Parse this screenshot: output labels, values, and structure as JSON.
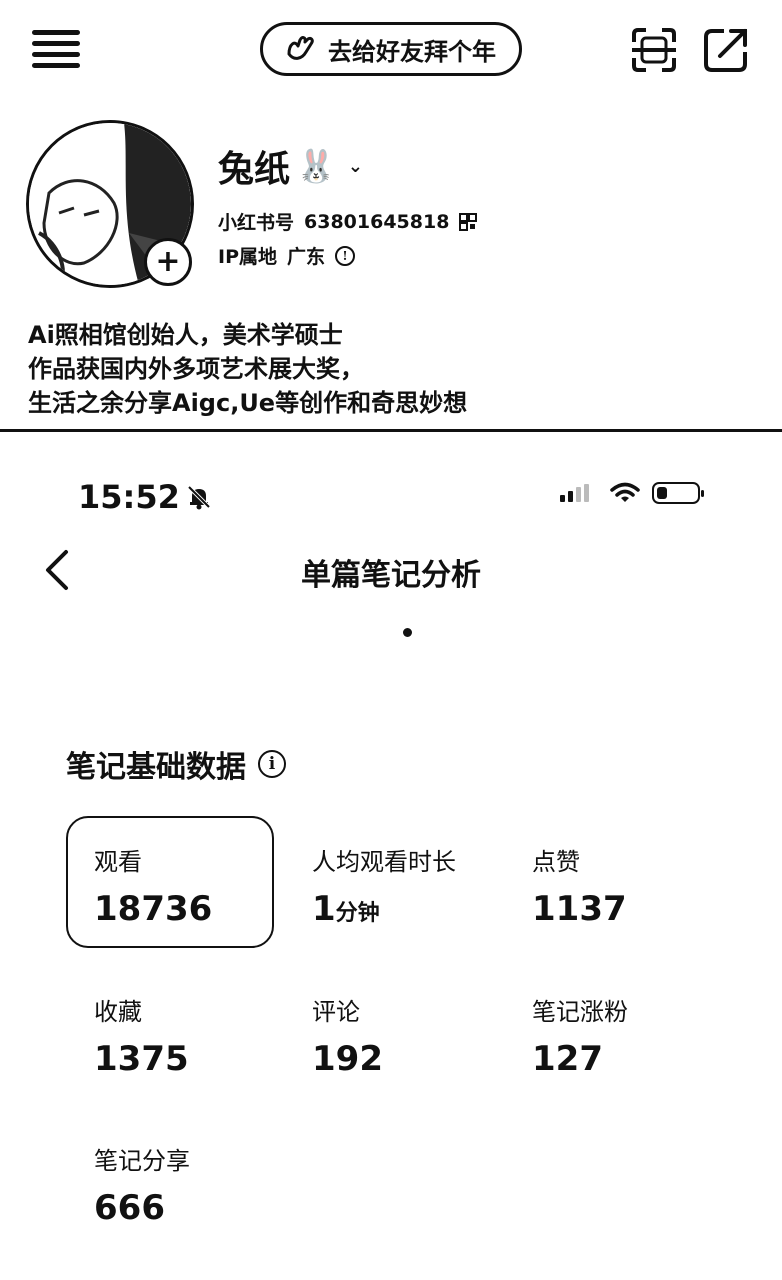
{
  "top": {
    "greet_button": "去给好友拜个年",
    "username": "兔纸",
    "username_emoji": "🐰",
    "red_id_label": "小红书号",
    "red_id": "63801645818",
    "ip_label": "IP属地",
    "ip_value": "广东",
    "bio": [
      "Ai照相馆创始人，美术学硕士",
      "作品获国内外多项艺术展大奖，",
      "生活之余分享Aigc,Ue等创作和奇思妙想"
    ]
  },
  "status_bar": {
    "time": "15:52"
  },
  "nav": {
    "title": "单篇笔记分析"
  },
  "section": {
    "title": "笔记基础数据"
  },
  "metrics": [
    {
      "label": "观看",
      "value": "18736",
      "unit": ""
    },
    {
      "label": "人均观看时长",
      "value": "1",
      "unit": "分钟"
    },
    {
      "label": "点赞",
      "value": "1137",
      "unit": ""
    },
    {
      "label": "收藏",
      "value": "1375",
      "unit": ""
    },
    {
      "label": "评论",
      "value": "192",
      "unit": ""
    },
    {
      "label": "笔记涨粉",
      "value": "127",
      "unit": ""
    },
    {
      "label": "笔记分享",
      "value": "666",
      "unit": ""
    }
  ],
  "colors": {
    "ink": "#111111",
    "background": "#ffffff"
  },
  "icons": [
    "menu-icon",
    "wave-hand-icon",
    "scan-icon",
    "share-icon",
    "add-icon",
    "chevron-down-icon",
    "qr-icon",
    "info-icon",
    "mute-bell-icon",
    "signal-icon",
    "wifi-icon",
    "battery-icon",
    "back-icon"
  ]
}
